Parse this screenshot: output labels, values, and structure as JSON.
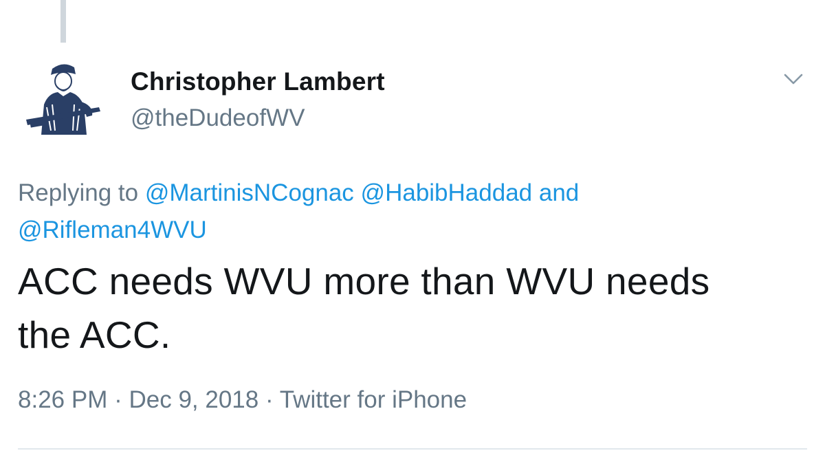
{
  "tweet": {
    "author": {
      "display_name": "Christopher Lambert",
      "handle": "@theDudeofWV",
      "avatar_icon": "mountaineer-avatar-icon"
    },
    "reply_context": {
      "prefix": "Replying to",
      "mentions": [
        "@MartinisNCognac",
        "@HabibHaddad",
        "@Rifleman4WVU"
      ],
      "conjunction": "and"
    },
    "text_line1": "ACC needs WVU more than WVU needs",
    "text_line2": "the ACC.",
    "time": "8:26 PM",
    "separator": "·",
    "date": "Dec 9, 2018",
    "source": "Twitter for iPhone",
    "menu_icon": "chevron-down-icon"
  },
  "colors": {
    "text_primary": "#14171a",
    "text_secondary": "#657786",
    "link": "#1b95e0",
    "thread_line": "#cfd6dc",
    "avatar_ink": "#2a3f66",
    "divider": "#e1e8ed"
  }
}
